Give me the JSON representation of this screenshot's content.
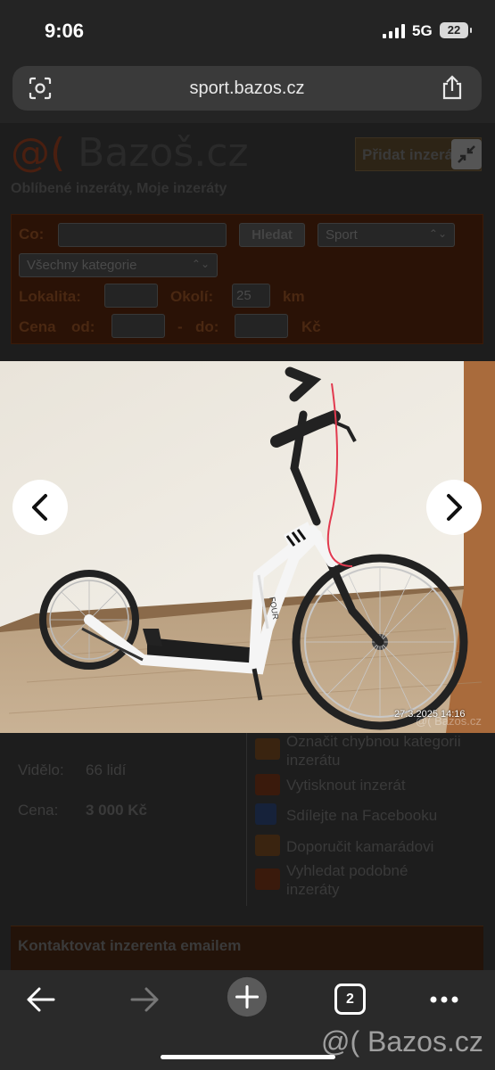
{
  "status": {
    "time": "9:06",
    "network": "5G",
    "battery": "22"
  },
  "browser": {
    "url": "sport.bazos.cz",
    "tabs_count": "2"
  },
  "site": {
    "logo_at": "@(",
    "logo_name": "Bazoš.cz",
    "add_button": "Přidat inzerát",
    "top_links": "Oblíbené inzeráty, Moje inzeráty"
  },
  "search": {
    "co_label": "Co:",
    "search_button": "Hledat",
    "section_select": "Sport",
    "category_select": "Všechny kategorie",
    "lokalita_label": "Lokalita:",
    "okoli_label": "Okolí:",
    "okoli_value": "25",
    "km_label": "km",
    "cena_label": "Cena",
    "od_label": "od:",
    "dash": "-",
    "do_label": "do:",
    "kc_label": "Kč"
  },
  "listing": {
    "seen_label": "Vidělo:",
    "seen_value": "66 lidí",
    "price_label": "Cena:",
    "price_value": "3 000 Kč"
  },
  "side_actions": [
    {
      "label": "Označit chybnou kategorii inzerátu",
      "icon": "arrows-icon"
    },
    {
      "label": "Vytisknout inzerát",
      "icon": "printer-icon"
    },
    {
      "label": "Sdílejte na Facebooku",
      "icon": "facebook-icon"
    },
    {
      "label": "Doporučit kamarádovi",
      "icon": "envelope-icon"
    },
    {
      "label": "Vyhledat podobné inzeráty",
      "icon": "sitemap-icon"
    }
  ],
  "contact_heading": "Kontaktovat inzerenta emailem",
  "photo": {
    "timestamp": "27.3.2025  14:16",
    "watermark": "@( Bazos.cz",
    "frame_text": "FOUR"
  },
  "bottom_watermark": "@( Bazos.cz",
  "colors": {
    "accent": "#ff6600",
    "overlay": "#1b1b1b",
    "photo_wall": "#efeae0"
  }
}
